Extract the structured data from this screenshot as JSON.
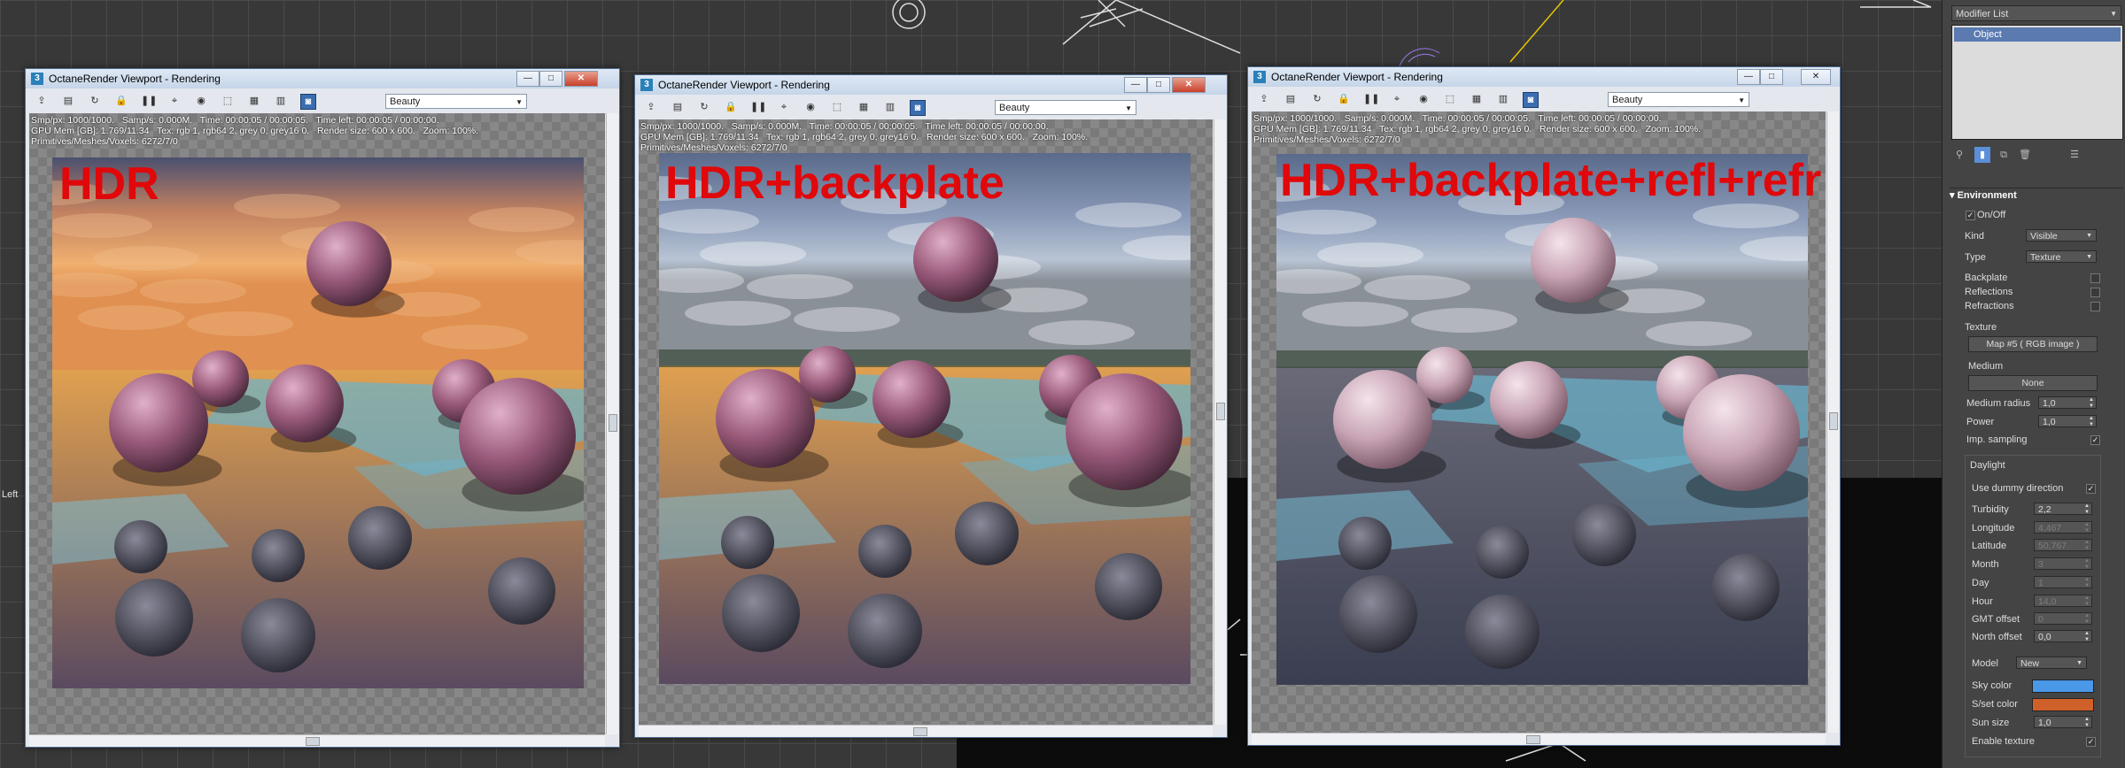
{
  "viewport": {
    "label": "Left",
    "colors": {
      "grid": "#4a4a4a",
      "background": "#383838",
      "dark_area": "#0c0c0c"
    }
  },
  "windows": [
    {
      "title": "OctaneRender Viewport - Rendering",
      "app_icon": "3",
      "pass": "Beauty",
      "stats": [
        "Smp/px: 1000/1000.   Samp/s: 0.000M.   Time: 00:00:05 / 00:00:05.   Time left: 00:00:05 / 00:00:00.",
        "GPU Mem [GB]: 1.769/11.34   Tex: rgb 1, rgb64 2, grey 0, grey16 0.   Render size: 600 x 600.   Zoom: 100%.",
        "Primitives/Meshes/Voxels: 6272/7/0"
      ],
      "caption": "HDR",
      "variant": "sunset"
    },
    {
      "title": "OctaneRender Viewport - Rendering",
      "app_icon": "3",
      "pass": "Beauty",
      "stats": [
        "Smp/px: 1000/1000.   Samp/s: 0.000M.   Time: 00:00:05 / 00:00:05.   Time left: 00:00:05 / 00:00:00.",
        "GPU Mem [GB]: 1.769/11.34   Tex: rgb 1, rgb64 2, grey 0, grey16 0.   Render size: 600 x 600.   Zoom: 100%.",
        "Primitives/Meshes/Voxels: 6272/7/0"
      ],
      "caption": "HDR+backplate",
      "variant": "backplate"
    },
    {
      "title": "OctaneRender Viewport - Rendering",
      "app_icon": "3",
      "pass": "Beauty",
      "stats": [
        "Smp/px: 1000/1000.   Samp/s: 0.000M.   Time: 00:00:05 / 00:00:05.   Time left: 00:00:05 / 00:00:00.",
        "GPU Mem [GB]: 1.769/11.34   Tex: rgb 1, rgb64 2, grey 0, grey16 0.   Render size: 600 x 600.   Zoom: 100%.",
        "Primitives/Meshes/Voxels: 6272/7/0"
      ],
      "caption": "HDR+backplate+refl+refr",
      "variant": "full"
    }
  ],
  "panel": {
    "modifier_list_label": "Modifier List",
    "modifier_items": [
      "Object"
    ],
    "rollout_title": "Environment",
    "onoff_label": "On/Off",
    "kind_label": "Kind",
    "kind_value": "Visible",
    "type_label": "Type",
    "type_value": "Texture",
    "backplate_label": "Backplate",
    "reflections_label": "Reflections",
    "refractions_label": "Refractions",
    "texture_label": "Texture",
    "texture_value": "Map #5  ( RGB image )",
    "medium_label": "Medium",
    "medium_value": "None",
    "medium_radius_label": "Medium radius",
    "medium_radius_value": "1,0",
    "power_label": "Power",
    "power_value": "1,0",
    "imp_sampling_label": "Imp. sampling",
    "daylight_label": "Daylight",
    "dummy_label": "Use dummy direction",
    "turbidity_label": "Turbidity",
    "turbidity_value": "2,2",
    "longitude_label": "Longitude",
    "longitude_value": "4,467",
    "latitude_label": "Latitude",
    "latitude_value": "50,767",
    "month_label": "Month",
    "month_value": "3",
    "day_label": "Day",
    "day_value": "1",
    "hour_label": "Hour",
    "hour_value": "14,0",
    "gmt_label": "GMT offset",
    "gmt_value": "0",
    "north_label": "North offset",
    "north_value": "0,0",
    "model_label": "Model",
    "model_value": "New",
    "sky_color_label": "Sky color",
    "sky_color": "#4a98e8",
    "sunset_color_label": "S/set color",
    "sunset_color": "#d0602a",
    "sun_size_label": "Sun size",
    "sun_size_value": "1,0",
    "enable_texture_label": "Enable texture",
    "checkmark": "✓"
  },
  "colors": {
    "caption_red": "#e0080a",
    "titlebar": "#c5d5e8",
    "active_tool": "#3b6eb0"
  }
}
